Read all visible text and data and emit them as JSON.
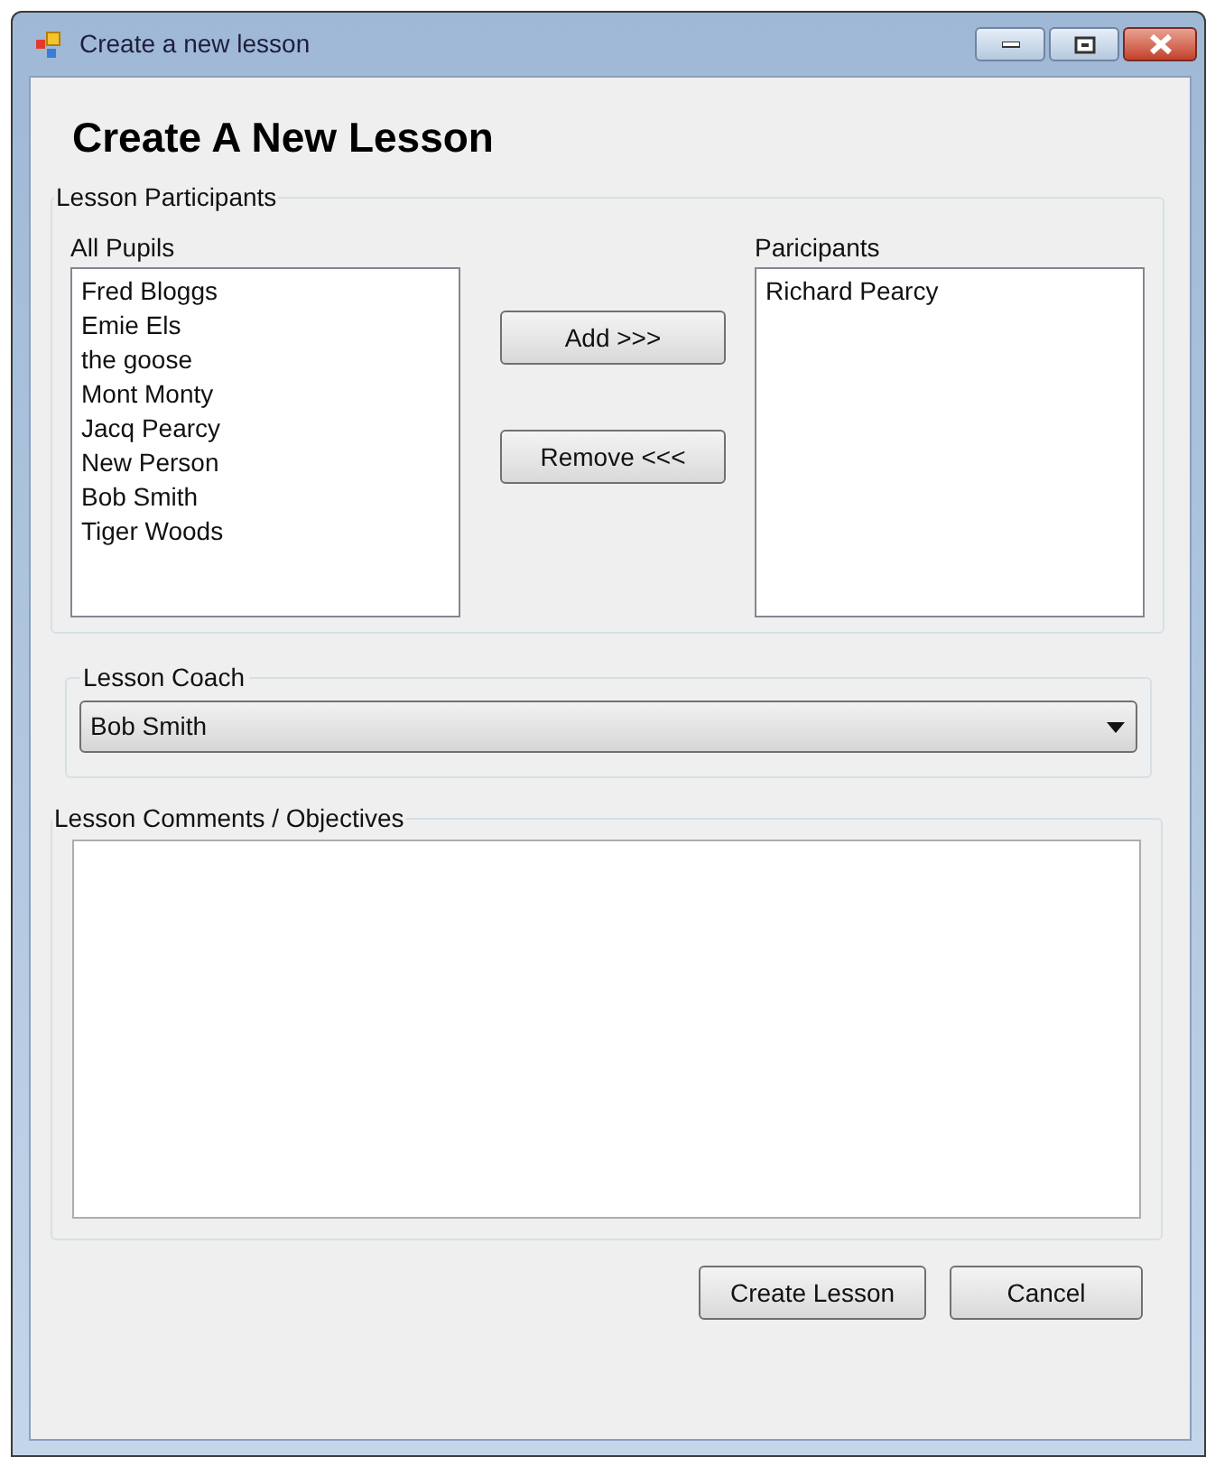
{
  "window": {
    "title": "Create a new lesson"
  },
  "heading": "Create A New Lesson",
  "participants_group": {
    "legend": "Lesson Participants",
    "all_pupils": {
      "label": "All Pupils",
      "items": [
        "Fred Bloggs",
        "Emie Els",
        "the goose",
        "Mont Monty",
        "Jacq Pearcy",
        "New Person",
        "Bob Smith",
        "Tiger Woods"
      ]
    },
    "add_button": "Add >>>",
    "remove_button": "Remove <<<",
    "participants": {
      "label": "Paricipants",
      "items": [
        "Richard Pearcy"
      ]
    }
  },
  "coach_group": {
    "legend": "Lesson Coach",
    "value": "Bob Smith"
  },
  "comments_group": {
    "legend": "Lesson Comments / Objectives"
  },
  "buttons": [
    "Create Lesson",
    "Cancel"
  ]
}
